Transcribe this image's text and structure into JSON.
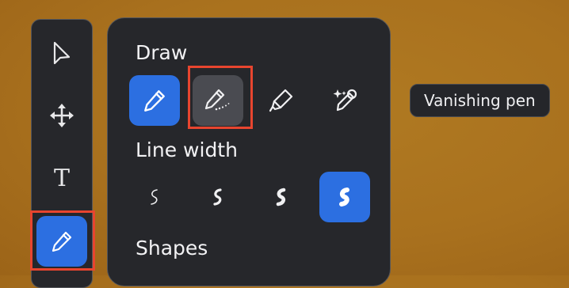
{
  "toolbar": {
    "tools": [
      {
        "name": "select",
        "icon": "pointer-arrow-icon"
      },
      {
        "name": "move",
        "icon": "move-arrows-icon"
      },
      {
        "name": "text",
        "icon": "text-icon",
        "glyph": "T"
      },
      {
        "name": "draw",
        "icon": "pencil-icon",
        "selected": true
      }
    ]
  },
  "panel": {
    "draw_title": "Draw",
    "draw_tools": [
      {
        "name": "pen",
        "icon": "pencil-icon",
        "selected": true
      },
      {
        "name": "vanishing-pen",
        "icon": "vanishing-pen-icon",
        "hovered": true
      },
      {
        "name": "highlighter",
        "icon": "highlighter-icon"
      },
      {
        "name": "magic-pen",
        "icon": "magic-pen-icon"
      }
    ],
    "line_width_title": "Line width",
    "line_widths": [
      {
        "level": 1,
        "selected": false
      },
      {
        "level": 2,
        "selected": false
      },
      {
        "level": 3,
        "selected": false
      },
      {
        "level": 4,
        "selected": true
      }
    ],
    "shapes_title": "Shapes"
  },
  "tooltip": {
    "text": "Vanishing pen"
  },
  "colors": {
    "accent": "#2c6fe1",
    "panel_bg": "#26272b",
    "hover_bg": "#4a4b51",
    "highlight": "#e8452f",
    "background": "#a9711e"
  }
}
